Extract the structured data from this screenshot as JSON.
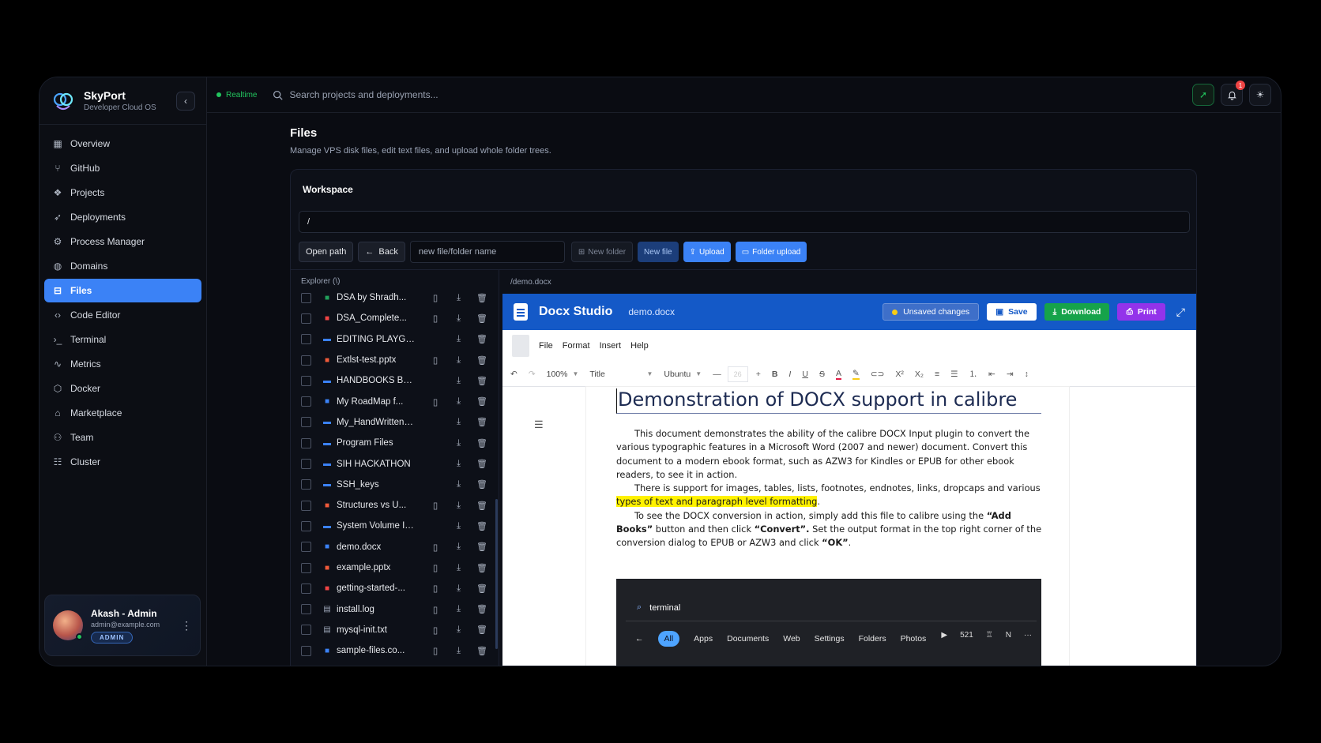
{
  "brand": {
    "name": "SkyPort",
    "subtitle": "Developer Cloud OS"
  },
  "sidebar": {
    "items": [
      {
        "label": "Overview",
        "icon": "grid-icon"
      },
      {
        "label": "GitHub",
        "icon": "git-branch-icon"
      },
      {
        "label": "Projects",
        "icon": "boxes-icon"
      },
      {
        "label": "Deployments",
        "icon": "rocket-icon"
      },
      {
        "label": "Process Manager",
        "icon": "cpu-icon"
      },
      {
        "label": "Domains",
        "icon": "globe-icon"
      },
      {
        "label": "Files",
        "icon": "folder-tree-icon",
        "active": true
      },
      {
        "label": "Code Editor",
        "icon": "code-icon"
      },
      {
        "label": "Terminal",
        "icon": "terminal-icon"
      },
      {
        "label": "Metrics",
        "icon": "activity-icon"
      },
      {
        "label": "Docker",
        "icon": "container-icon"
      },
      {
        "label": "Marketplace",
        "icon": "store-icon"
      },
      {
        "label": "Team",
        "icon": "users-icon"
      },
      {
        "label": "Cluster",
        "icon": "server-icon"
      }
    ]
  },
  "user": {
    "name": "Akash - Admin",
    "email": "admin@example.com",
    "role": "ADMIN"
  },
  "topbar": {
    "status": "Realtime",
    "search_placeholder": "Search projects and deployments...",
    "notifications": "1"
  },
  "page": {
    "title": "Files",
    "subtitle": "Manage VPS disk files, edit text files, and upload whole folder trees."
  },
  "workspace": {
    "title": "Workspace",
    "path": "/",
    "open_path": "Open path",
    "back": "Back",
    "name_placeholder": "new file/folder name",
    "new_folder": "New folder",
    "new_file": "New file",
    "upload": "Upload",
    "folder_upload": "Folder upload"
  },
  "explorer": {
    "title": "Explorer (\\)",
    "files": [
      {
        "name": "DSA by Shradh...",
        "type": "excel"
      },
      {
        "name": "DSA_Complete...",
        "type": "pdf"
      },
      {
        "name": "EDITING PLAYGRO...",
        "type": "folder"
      },
      {
        "name": "Extlst-test.pptx",
        "type": "pptx"
      },
      {
        "name": "HANDBOOKS BY HA...",
        "type": "folder"
      },
      {
        "name": "My RoadMap f...",
        "type": "doc"
      },
      {
        "name": "My_HandWritten_Notes",
        "type": "folder"
      },
      {
        "name": "Program Files",
        "type": "folder"
      },
      {
        "name": "SIH HACKATHON",
        "type": "folder"
      },
      {
        "name": "SSH_keys",
        "type": "folder"
      },
      {
        "name": "Structures vs U...",
        "type": "pptx"
      },
      {
        "name": "System Volume Infor...",
        "type": "folder"
      },
      {
        "name": "demo.docx",
        "type": "doc"
      },
      {
        "name": "example.pptx",
        "type": "pptx"
      },
      {
        "name": "getting-started-...",
        "type": "pdf"
      },
      {
        "name": "install.log",
        "type": "text"
      },
      {
        "name": "mysql-init.txt",
        "type": "text"
      },
      {
        "name": "sample-files.co...",
        "type": "doc"
      }
    ]
  },
  "preview": {
    "path": "/demo.docx",
    "app_name": "Docx Studio",
    "file": "demo.docx",
    "unsaved": "Unsaved changes",
    "save": "Save",
    "download": "Download",
    "print": "Print",
    "menu": [
      "File",
      "Format",
      "Insert",
      "Help"
    ],
    "zoom": "100%",
    "style": "Title",
    "font": "Ubuntu",
    "font_size": "26"
  },
  "document": {
    "heading": "Demonstration of DOCX support in calibre",
    "p1": "This document demonstrates the ability of the calibre DOCX Input plugin to convert the various typographic features in a Microsoft Word (2007 and newer) document. Convert this document to a modern ebook format, such as AZW3 for Kindles or EPUB for other ebook readers, to see it in action.",
    "p2_a": "There is support for images, tables, lists, footnotes, endnotes, links, dropcaps and various ",
    "p2_hl": "types of text and paragraph level formatting",
    "p2_b": ".",
    "p3_a": "To see the DOCX conversion in action, simply add this file to calibre using the ",
    "p3_b1": "“Add Books”",
    "p3_c": " button and then click ",
    "p3_b2": "“Convert”.",
    "p3_d": "  Set the output format in the top right corner of the conversion dialog to EPUB or AZW3 and click ",
    "p3_b3": "“OK”",
    "p3_e": ".",
    "screenshot": {
      "query": "terminal",
      "tabs": [
        "All",
        "Apps",
        "Documents",
        "Web",
        "Settings",
        "Folders",
        "Photos"
      ],
      "count": "521",
      "letter": "N"
    }
  }
}
